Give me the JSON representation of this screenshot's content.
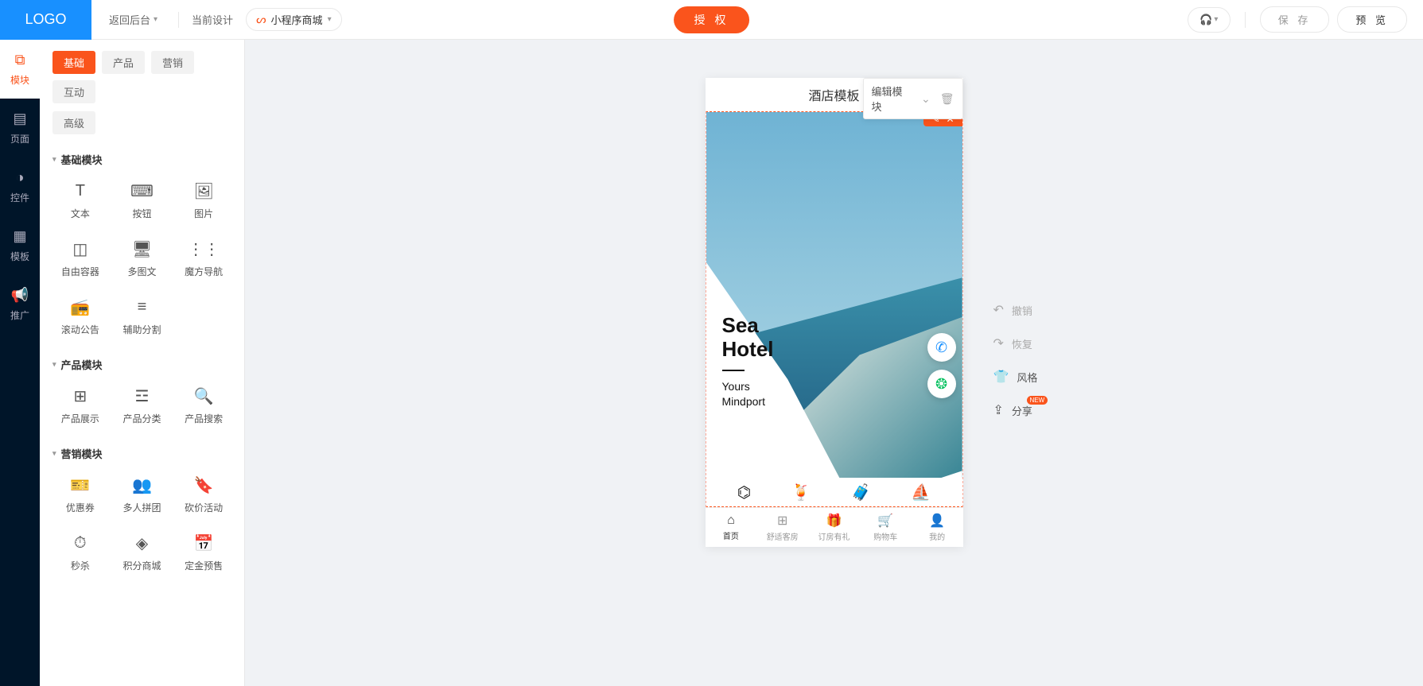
{
  "topbar": {
    "logo": "LOGO",
    "back": "返回后台",
    "current_label": "当前设计",
    "design_name": "小程序商城",
    "auth": "授 权",
    "save": "保 存",
    "preview": "预 览"
  },
  "leftnav": [
    {
      "key": "modules",
      "label": "模块",
      "icon": "⧉"
    },
    {
      "key": "pages",
      "label": "页面",
      "icon": "▤"
    },
    {
      "key": "controls",
      "label": "控件",
      "icon": "◑"
    },
    {
      "key": "templates",
      "label": "模板",
      "icon": "▦"
    },
    {
      "key": "promo",
      "label": "推广",
      "icon": "📢"
    }
  ],
  "tabs": {
    "row1": [
      "基础",
      "产品",
      "营销",
      "互动"
    ],
    "row2": [
      "高级"
    ],
    "active": "基础"
  },
  "sections": [
    {
      "title": "基础模块",
      "items": [
        {
          "label": "文本",
          "icon": "T"
        },
        {
          "label": "按钮",
          "icon": "⌨"
        },
        {
          "label": "图片",
          "icon": "🖼"
        },
        {
          "label": "自由容器",
          "icon": "◫"
        },
        {
          "label": "多图文",
          "icon": "🖥"
        },
        {
          "label": "魔方导航",
          "icon": "⋮⋮"
        },
        {
          "label": "滚动公告",
          "icon": "📻"
        },
        {
          "label": "辅助分割",
          "icon": "≡"
        }
      ]
    },
    {
      "title": "产品模块",
      "items": [
        {
          "label": "产品展示",
          "icon": "⊞"
        },
        {
          "label": "产品分类",
          "icon": "☲"
        },
        {
          "label": "产品搜索",
          "icon": "🔍"
        }
      ]
    },
    {
      "title": "营销模块",
      "items": [
        {
          "label": "优惠券",
          "icon": "🎫"
        },
        {
          "label": "多人拼团",
          "icon": "👥"
        },
        {
          "label": "砍价活动",
          "icon": "🔖"
        },
        {
          "label": "秒杀",
          "icon": "⏱"
        },
        {
          "label": "积分商城",
          "icon": "◈"
        },
        {
          "label": "定金预售",
          "icon": "📅"
        }
      ]
    }
  ],
  "phone": {
    "title": "酒店模板",
    "tooltip": "编辑模块",
    "hero_title1": "Sea",
    "hero_title2": "Hotel",
    "hero_sub1": "Yours",
    "hero_sub2": "Mindport",
    "tabs": [
      {
        "label": "首页",
        "icon": "⌂"
      },
      {
        "label": "舒适客房",
        "icon": "⊞"
      },
      {
        "label": "订房有礼",
        "icon": "🎁"
      },
      {
        "label": "购物车",
        "icon": "🛒"
      },
      {
        "label": "我的",
        "icon": "👤"
      }
    ]
  },
  "right_tools": {
    "undo": "撤销",
    "redo": "恢复",
    "style": "风格",
    "share": "分享",
    "new": "NEW"
  }
}
